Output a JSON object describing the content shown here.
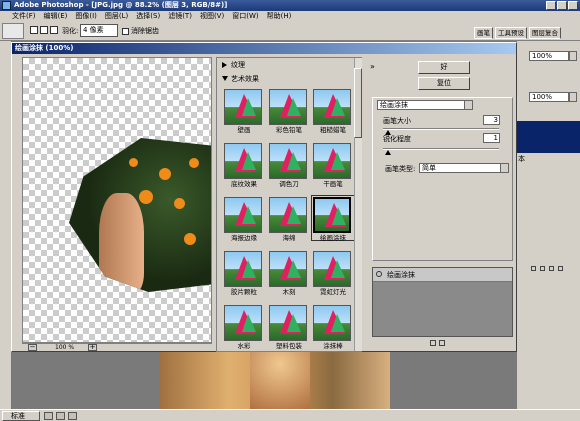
{
  "app": {
    "title": "Adobe Photoshop - [JPG.jpg @ 88.2% (图层 3, RGB/8#)]"
  },
  "menu": [
    "文件(F)",
    "编辑(E)",
    "图像(I)",
    "图层(L)",
    "选择(S)",
    "滤镜(T)",
    "视图(V)",
    "窗口(W)",
    "帮助(H)"
  ],
  "options": {
    "feather_label": "羽化:",
    "feather_value": "4 像素",
    "antialias_label": "消除锯齿"
  },
  "palette_tabs": [
    "画笔",
    "工具预设",
    "图层复合"
  ],
  "right_panel": {
    "opacity1": "100%",
    "opacity2": "100%",
    "label": "本"
  },
  "dialog": {
    "title": "绘画涂抹 (100%)",
    "zoom": "100 %",
    "zoom_minus": "−",
    "zoom_plus": "+",
    "ok_label": "好",
    "reset_label": "复位",
    "collapse": "»",
    "folders": {
      "texture": "纹理",
      "artistic": "艺术效果"
    },
    "thumbs": [
      "壁画",
      "彩色铅笔",
      "粗糙蜡笔",
      "底纹效果",
      "调色刀",
      "干画笔",
      "海报边缘",
      "海绵",
      "绘画涂抹",
      "胶片颗粒",
      "木刻",
      "霓虹灯光",
      "水彩",
      "塑料包装",
      "涂抹棒"
    ],
    "filter_select": "绘画涂抹",
    "brush_size_label": "画笔大小",
    "brush_size_value": "3",
    "sharpness_label": "锐化程度",
    "sharpness_value": "1",
    "brush_type_label": "画笔类型:",
    "brush_type_value": "简单",
    "layer_name": "绘画涂抹"
  },
  "status": {
    "start_label": "标准"
  }
}
